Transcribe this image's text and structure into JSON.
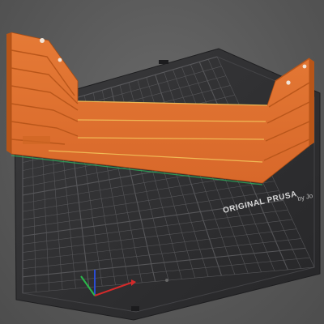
{
  "viewport": {
    "bed_brand_line1": "ORIGINAL PRUSA",
    "bed_brand_line2": "by Jo",
    "model_color": "#e2702b",
    "model_shade": "#c55a1c",
    "bed_color": "#2f2f31",
    "grid_color": "#5d5d60",
    "axis_x_color": "#d42a2a",
    "axis_y_color": "#2ab84a",
    "axis_z_color": "#2a4cd4"
  }
}
